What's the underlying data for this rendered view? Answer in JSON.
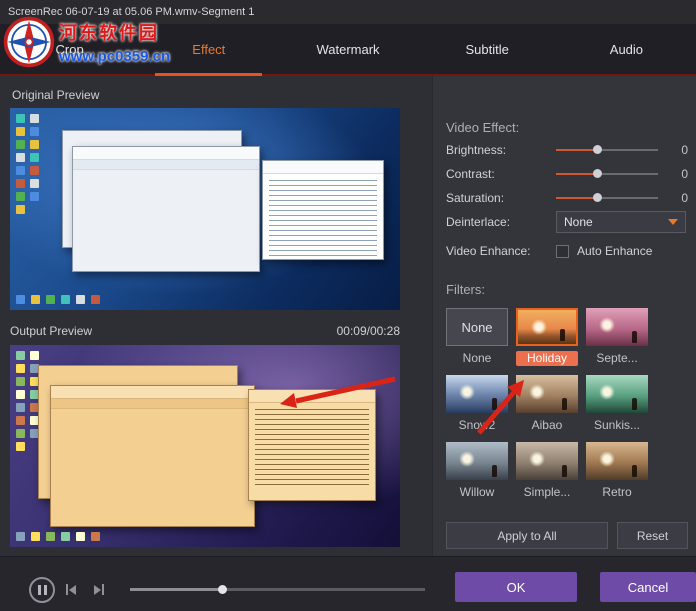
{
  "window_title": "ScreenRec 06-07-19 at 05.06 PM.wmv-Segment 1",
  "watermark": {
    "site_name": "河东软件园",
    "site_url": "www.pc0359.cn"
  },
  "tabs": [
    {
      "label": "Crop"
    },
    {
      "label": "Effect"
    },
    {
      "label": "Watermark"
    },
    {
      "label": "Subtitle"
    },
    {
      "label": "Audio"
    }
  ],
  "preview": {
    "original_label": "Original Preview",
    "output_label": "Output Preview",
    "time_display": "00:09/00:28"
  },
  "effect_panel": {
    "title": "Video Effect:",
    "brightness_label": "Brightness:",
    "brightness_value": "0",
    "contrast_label": "Contrast:",
    "contrast_value": "0",
    "saturation_label": "Saturation:",
    "saturation_value": "0",
    "deinterlace_label": "Deinterlace:",
    "deinterlace_value": "None",
    "video_enhance_label": "Video Enhance:",
    "auto_enhance_label": "Auto Enhance"
  },
  "filters": {
    "title": "Filters:",
    "selected": "Holiday",
    "items": [
      {
        "name": "None"
      },
      {
        "name": "Holiday"
      },
      {
        "name": "Septe..."
      },
      {
        "name": "Snow2"
      },
      {
        "name": "Aibao"
      },
      {
        "name": "Sunkis..."
      },
      {
        "name": "Willow"
      },
      {
        "name": "Simple..."
      },
      {
        "name": "Retro"
      }
    ]
  },
  "actions": {
    "apply_to_all": "Apply to All",
    "reset": "Reset",
    "ok": "OK",
    "cancel": "Cancel"
  },
  "colors": {
    "accent_orange": "#e8641e",
    "button_purple": "#6d4ba6",
    "arrow_red": "#da2418"
  }
}
